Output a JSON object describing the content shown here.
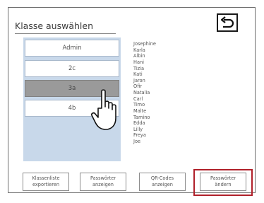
{
  "header": {
    "title": "Klasse auswählen",
    "back_icon": "undo-arrow-icon"
  },
  "classes": {
    "items": [
      {
        "label": "Admin",
        "selected": false
      },
      {
        "label": "2c",
        "selected": false
      },
      {
        "label": "3a",
        "selected": true
      },
      {
        "label": "4b",
        "selected": false
      }
    ]
  },
  "students": [
    "Josephine",
    "Karla",
    "Albin",
    "Hani",
    "Tizia",
    "Kati",
    "Jaron",
    "Ofir",
    "Natalia",
    "Carl",
    "Timo",
    "Malte",
    "Tamino",
    "Edda",
    "Lilly",
    "Freya",
    "Joe"
  ],
  "buttons": {
    "export": "Klassenliste\nexportieren",
    "show_passwords": "Passwörter\nanzeigen",
    "show_qr": "QR-Codes\nanzeigen",
    "change_passwords": "Passwörter\nändern"
  },
  "colors": {
    "selected_class_bg": "#9a9a9a",
    "class_area_bg": "#c8d8ea",
    "highlight_border": "#b0202a"
  },
  "cursor_icon": "hand-pointer-icon"
}
